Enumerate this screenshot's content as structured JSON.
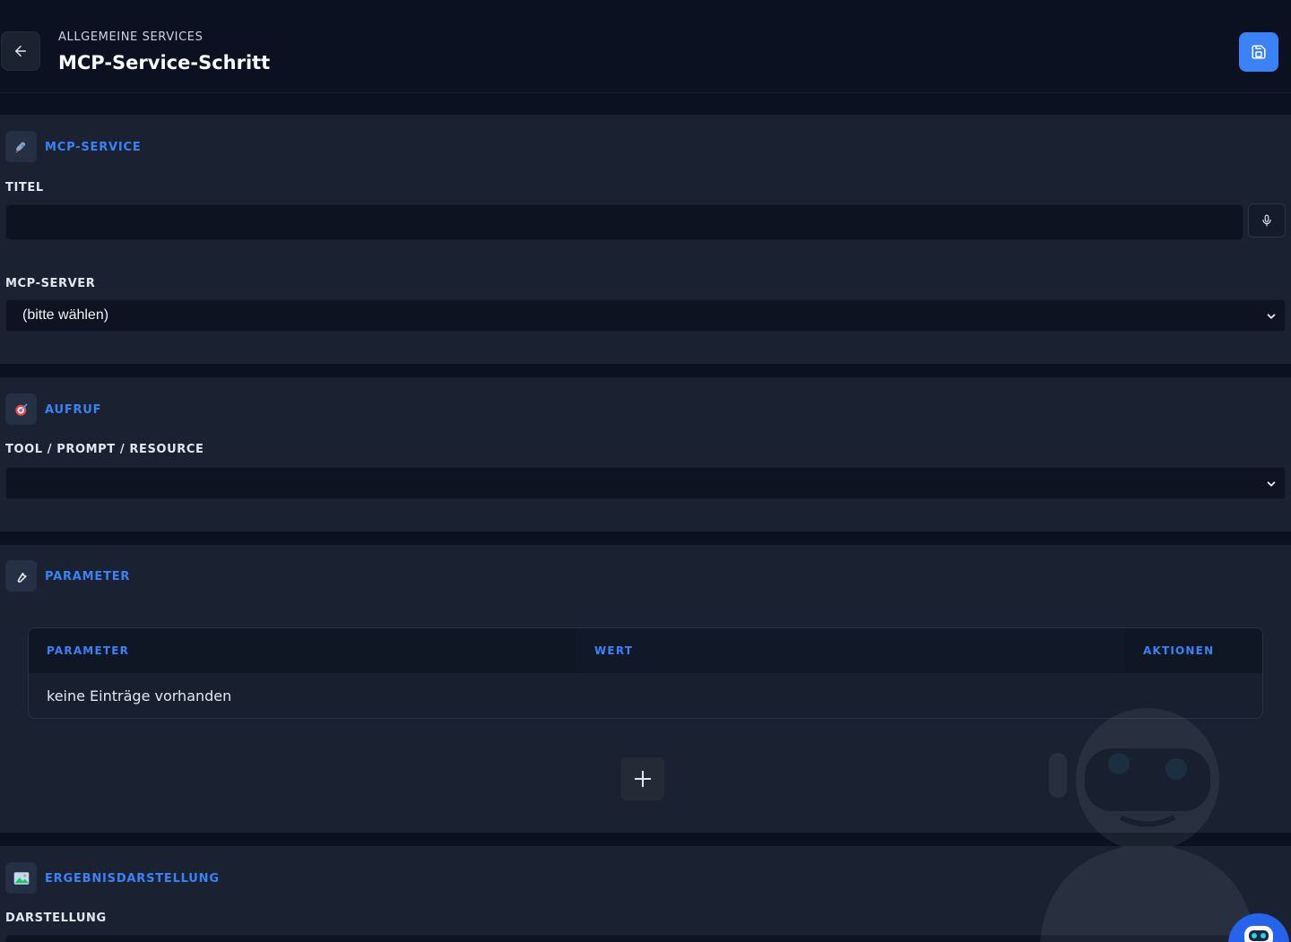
{
  "header": {
    "breadcrumb": "ALLGEMEINE SERVICES",
    "title": "MCP-Service-Schritt",
    "back_icon": "arrow-left-icon",
    "save_icon": "save-icon"
  },
  "sections": {
    "mcp_service": {
      "title": "MCP-SERVICE",
      "icon": "rocket-icon",
      "titel_label": "TITEL",
      "titel_value": "",
      "server_label": "MCP-SERVER",
      "server_selected": "(bitte wählen)"
    },
    "aufruf": {
      "title": "AUFRUF",
      "icon": "target-icon",
      "tool_label": "TOOL / PROMPT / RESOURCE",
      "tool_selected": ""
    },
    "parameter": {
      "title": "PARAMETER",
      "icon": "wrench-icon",
      "columns": [
        "PARAMETER",
        "WERT",
        "AKTIONEN"
      ],
      "empty_text": "keine Einträge vorhanden"
    },
    "ergebnis": {
      "title": "ERGEBNISDARSTELLUNG",
      "icon": "image-icon",
      "darstellung_label": "DARSTELLUNG"
    }
  },
  "colors": {
    "accent": "#3b82f6",
    "background": "#0b1120",
    "section_bg": "#1a2131"
  }
}
